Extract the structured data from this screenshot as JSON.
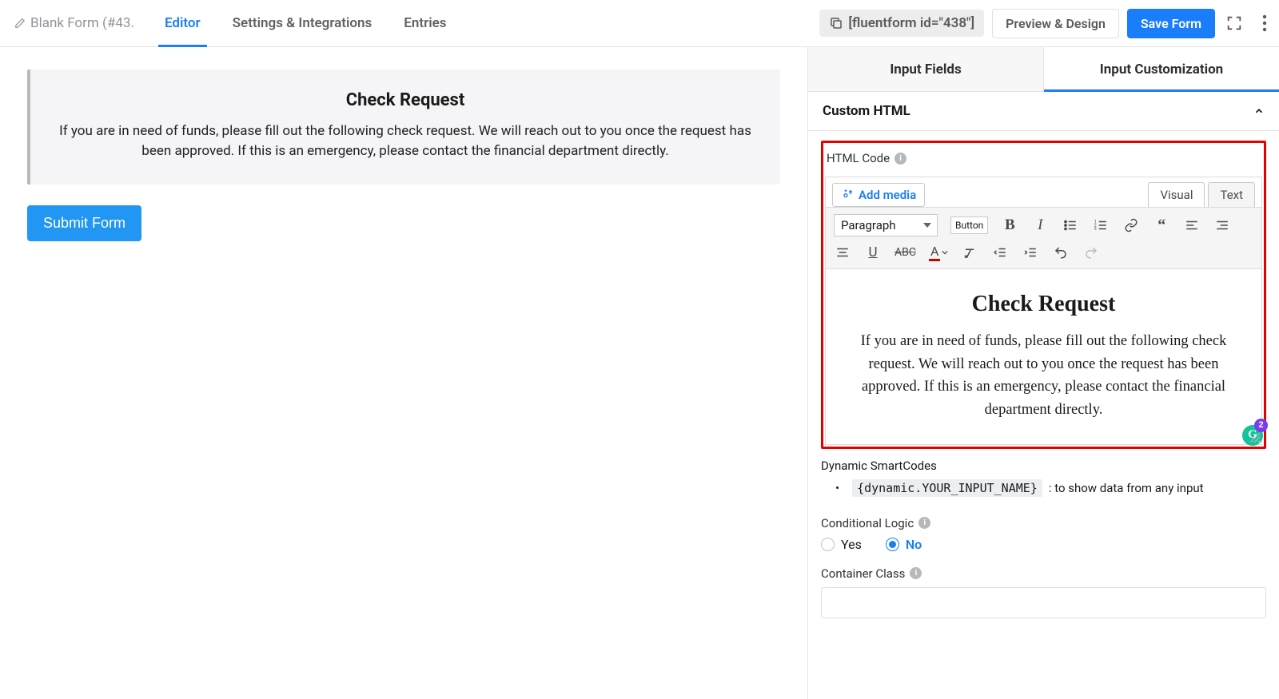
{
  "topbar": {
    "title": "Blank Form (#43…",
    "tabs": [
      "Editor",
      "Settings & Integrations",
      "Entries"
    ],
    "active_tab": 0,
    "shortcode": "[fluentform id=\"438\"]",
    "preview_btn": "Preview & Design",
    "save_btn": "Save Form"
  },
  "canvas": {
    "block_title": "Check Request",
    "block_text": "If you are in need of funds, please fill out the following check request. We will reach out to you once the request has been approved. If this is an emergency, please contact the financial department directly.",
    "submit_label": "Submit Form"
  },
  "sidepanel": {
    "tabs": [
      "Input Fields",
      "Input Customization"
    ],
    "active_tab": 1,
    "section_title": "Custom HTML",
    "html_code_label": "HTML Code",
    "add_media_label": "Add media",
    "view_tabs": [
      "Visual",
      "Text"
    ],
    "active_view": 0,
    "paragraph_label": "Paragraph",
    "button_tag_label": "Button",
    "rte_title": "Check Request",
    "rte_body": "If you are in need of funds, please fill out the following check request. We will reach out to you once the request has been approved. If this is an emergency, please contact the financial department directly.",
    "grammarly_badge": "2",
    "dynamic_label": "Dynamic SmartCodes",
    "dynamic_code": "{dynamic.YOUR_INPUT_NAME}",
    "dynamic_desc": ": to show data from any input",
    "cond_label": "Conditional Logic",
    "cond_options": [
      "Yes",
      "No"
    ],
    "cond_selected": 1,
    "container_label": "Container Class",
    "container_value": ""
  }
}
